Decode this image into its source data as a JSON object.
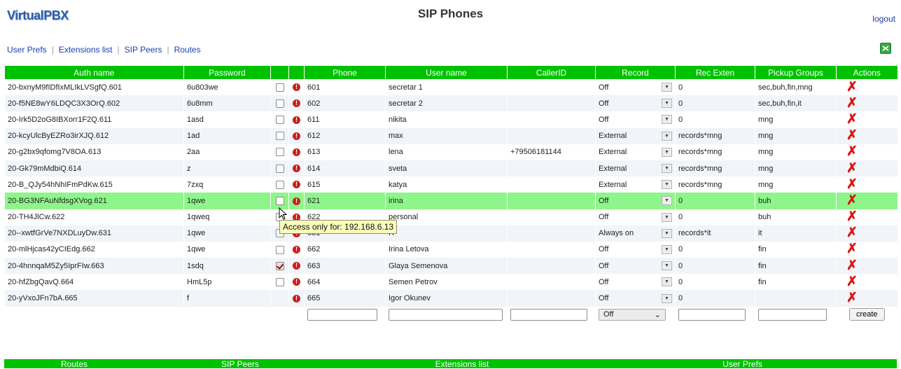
{
  "header": {
    "logo_text": "VirtualPBX",
    "title": "SIP Phones",
    "logout_label": "logout"
  },
  "nav": {
    "items": [
      "User Prefs",
      "Extensions list",
      "SIP Peers",
      "Routes"
    ],
    "export_icon": "spreadsheet-export-icon"
  },
  "table": {
    "columns": [
      "Auth name",
      "Password",
      "",
      "",
      "Phone",
      "User name",
      "CallerID",
      "Record",
      "Rec Exten",
      "Pickup Groups",
      "Actions"
    ],
    "rows": [
      {
        "auth": "20-bxnyM9fIDfIxMLIkLVSgfQ.601",
        "password": "6u803we",
        "checked": false,
        "phone": "601",
        "user": "secretar 1",
        "callerid": "",
        "record": "Off",
        "rec_exten": "0",
        "pickup": "sec,buh,fin,mng"
      },
      {
        "auth": "20-f5NE8wY6LDQC3X3OrQ.602",
        "password": "6u8mm",
        "checked": false,
        "phone": "602",
        "user": "secretar 2",
        "callerid": "",
        "record": "Off",
        "rec_exten": "0",
        "pickup": "sec,buh,fin,it"
      },
      {
        "auth": "20-Irk5D2oG8IBXorr1F2Q.611",
        "password": "1asd",
        "checked": false,
        "phone": "611",
        "user": "nikita",
        "callerid": "",
        "record": "Off",
        "rec_exten": "0",
        "pickup": "mng"
      },
      {
        "auth": "20-kcyUlcByEZRo3irXJQ.612",
        "password": "1ad",
        "checked": false,
        "phone": "612",
        "user": "max",
        "callerid": "",
        "record": "External",
        "rec_exten": "records*mng",
        "pickup": "mng"
      },
      {
        "auth": "20-g2bx9qfomg7V8OA.613",
        "password": "2aa",
        "checked": false,
        "phone": "613",
        "user": "lena",
        "callerid": "+79506181144",
        "record": "External",
        "rec_exten": "records*mng",
        "pickup": "mng"
      },
      {
        "auth": "20-Gk79mMdbiQ.614",
        "password": "z",
        "checked": false,
        "phone": "614",
        "user": "sveta",
        "callerid": "",
        "record": "External",
        "rec_exten": "records*mng",
        "pickup": "mng"
      },
      {
        "auth": "20-B_QJy54hNhIFmPdKw.615",
        "password": "7zxq",
        "checked": false,
        "phone": "615",
        "user": "katya",
        "callerid": "",
        "record": "External",
        "rec_exten": "records*mng",
        "pickup": "mng"
      },
      {
        "auth": "20-BG3NFAuNfdsgXVog.621",
        "password": "1qwe",
        "checked": false,
        "phone": "621",
        "user": "irina",
        "callerid": "",
        "record": "Off",
        "rec_exten": "0",
        "pickup": "buh"
      },
      {
        "auth": "20-TH4JlCw.622",
        "password": "1qweq",
        "checked": false,
        "phone": "622",
        "user": "personal",
        "callerid": "",
        "record": "Off",
        "rec_exten": "0",
        "pickup": "buh"
      },
      {
        "auth": "20--xwtfGrVe7NXDLuyDw.631",
        "password": "1qwe",
        "checked": false,
        "phone": "631",
        "user": "IT",
        "callerid": "",
        "record": "Always on",
        "rec_exten": "records*it",
        "pickup": "it"
      },
      {
        "auth": "20-mlHjcas42yCIEdg.662",
        "password": "1qwe",
        "checked": false,
        "phone": "662",
        "user": "Irina Letova",
        "callerid": "",
        "record": "Off",
        "rec_exten": "0",
        "pickup": "fin"
      },
      {
        "auth": "20-4hnnqaM5Zy5IprFIw.663",
        "password": "1sdq",
        "checked": true,
        "phone": "663",
        "user": "Glaya Semenova",
        "callerid": "",
        "record": "Off",
        "rec_exten": "0",
        "pickup": "fin"
      },
      {
        "auth": "20-hfZbgQavQ.664",
        "password": "HmL5p",
        "checked": false,
        "phone": "664",
        "user": "Semen Petrov",
        "callerid": "",
        "record": "Off",
        "rec_exten": "0",
        "pickup": "fin"
      },
      {
        "auth": "20-yVxoJFn7bA.665",
        "password": "f",
        "checked": null,
        "phone": "665",
        "user": "Igor Okunev",
        "callerid": "",
        "record": "Off",
        "rec_exten": "0",
        "pickup": ""
      }
    ],
    "highlight_row": 7,
    "new_row": {
      "record_default": "Off",
      "create_label": "create"
    }
  },
  "tooltip": {
    "text": "Access only for: 192.168.6.13"
  },
  "footer": {
    "items": [
      "Routes",
      "SIP Peers",
      "Extensions list",
      "User Prefs"
    ]
  },
  "colors": {
    "header_green": "#00c200",
    "highlight": "#8ef58a",
    "delete_red": "#e01010",
    "alt_row": "#f1f4f8"
  }
}
